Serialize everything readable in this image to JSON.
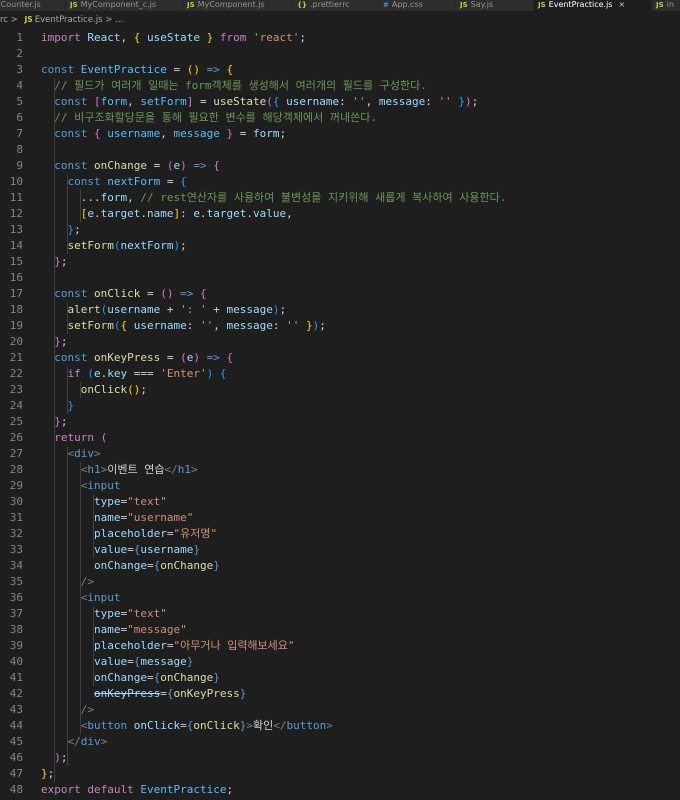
{
  "tabs": [
    {
      "label": "Counter.js",
      "icon": "JS"
    },
    {
      "label": "MyComponent_c.js",
      "icon": "JS"
    },
    {
      "label": "MyComponent.js",
      "icon": "JS"
    },
    {
      "label": ".prettierrc",
      "icon": "{}"
    },
    {
      "label": "App.css",
      "icon": "#"
    },
    {
      "label": "Say.js",
      "icon": "JS"
    },
    {
      "label": "EventPractice.js",
      "icon": "JS",
      "active": true
    },
    {
      "label": "in",
      "icon": "JS"
    }
  ],
  "breadcrumb": {
    "folder": "rc",
    "file_icon": "JS",
    "file": "EventPractice.js",
    "tail": "..."
  },
  "colors": {
    "editor_bg": "#1e1e1e",
    "keyword": "#569cd6",
    "control": "#c586c0",
    "string": "#ce9178",
    "comment": "#6a9955",
    "variable": "#9cdcfe",
    "function": "#dcdcaa"
  },
  "code_lines": [
    [
      [
        "kc",
        "import "
      ],
      [
        "var",
        "React"
      ],
      [
        "pn",
        ", "
      ],
      [
        "b1",
        "{ "
      ],
      [
        "var",
        "useState "
      ],
      [
        "b1",
        "}"
      ],
      [
        "kc",
        " from "
      ],
      [
        "str",
        "'react'"
      ],
      [
        "pn",
        ";"
      ]
    ],
    [],
    [
      [
        "kw",
        "const "
      ],
      [
        "cn",
        "EventPractice"
      ],
      [
        "pn",
        " = "
      ],
      [
        "b1",
        "()"
      ],
      [
        "kw",
        " => "
      ],
      [
        "b1",
        "{"
      ]
    ],
    [
      [
        "pn",
        "  "
      ],
      [
        "cm",
        "// 필드가 여러개 일때는 form객체를 생성해서 여러개의 필드를 구성한다."
      ]
    ],
    [
      [
        "pn",
        "  "
      ],
      [
        "kw",
        "const "
      ],
      [
        "b2",
        "["
      ],
      [
        "cn",
        "form"
      ],
      [
        "pn",
        ", "
      ],
      [
        "cn",
        "setForm"
      ],
      [
        "b2",
        "]"
      ],
      [
        "pn",
        " = "
      ],
      [
        "fn",
        "useState"
      ],
      [
        "b2",
        "("
      ],
      [
        "b3",
        "{ "
      ],
      [
        "var",
        "username"
      ],
      [
        "pn",
        ": "
      ],
      [
        "str",
        "''"
      ],
      [
        "pn",
        ", "
      ],
      [
        "var",
        "message"
      ],
      [
        "pn",
        ": "
      ],
      [
        "str",
        "'' "
      ],
      [
        "b3",
        "}"
      ],
      [
        "b2",
        ")"
      ],
      [
        "pn",
        ";"
      ]
    ],
    [
      [
        "pn",
        "  "
      ],
      [
        "cm",
        "// 비구조화할당문을 통해 필요한 변수를 해당객체에서 꺼내쓴다."
      ]
    ],
    [
      [
        "pn",
        "  "
      ],
      [
        "kw",
        "const "
      ],
      [
        "b2",
        "{ "
      ],
      [
        "cn",
        "username"
      ],
      [
        "pn",
        ", "
      ],
      [
        "cn",
        "message "
      ],
      [
        "b2",
        "}"
      ],
      [
        "pn",
        " = "
      ],
      [
        "var",
        "form"
      ],
      [
        "pn",
        ";"
      ]
    ],
    [],
    [
      [
        "pn",
        "  "
      ],
      [
        "kw",
        "const "
      ],
      [
        "fn",
        "onChange"
      ],
      [
        "pn",
        " = "
      ],
      [
        "b2",
        "("
      ],
      [
        "var",
        "e"
      ],
      [
        "b2",
        ")"
      ],
      [
        "kw",
        " => "
      ],
      [
        "b2",
        "{"
      ]
    ],
    [
      [
        "pn",
        "    "
      ],
      [
        "kw",
        "const "
      ],
      [
        "cn",
        "nextForm"
      ],
      [
        "pn",
        " = "
      ],
      [
        "b3",
        "{"
      ]
    ],
    [
      [
        "pn",
        "      ..."
      ],
      [
        "var",
        "form"
      ],
      [
        "pn",
        ", "
      ],
      [
        "cm",
        "// rest연산자를 사용하여 불변성을 지키위해 새롭게 복사하여 사용한다."
      ]
    ],
    [
      [
        "pn",
        "      "
      ],
      [
        "b1",
        "["
      ],
      [
        "var",
        "e"
      ],
      [
        "pn",
        "."
      ],
      [
        "var",
        "target"
      ],
      [
        "pn",
        "."
      ],
      [
        "var",
        "name"
      ],
      [
        "b1",
        "]"
      ],
      [
        "pn",
        ": "
      ],
      [
        "var",
        "e"
      ],
      [
        "pn",
        "."
      ],
      [
        "var",
        "target"
      ],
      [
        "pn",
        "."
      ],
      [
        "var",
        "value"
      ],
      [
        "pn",
        ","
      ]
    ],
    [
      [
        "pn",
        "    "
      ],
      [
        "b3",
        "}"
      ],
      [
        "pn",
        ";"
      ]
    ],
    [
      [
        "pn",
        "    "
      ],
      [
        "fn",
        "setForm"
      ],
      [
        "b3",
        "("
      ],
      [
        "var",
        "nextForm"
      ],
      [
        "b3",
        ")"
      ],
      [
        "pn",
        ";"
      ]
    ],
    [
      [
        "pn",
        "  "
      ],
      [
        "b2",
        "}"
      ],
      [
        "pn",
        ";"
      ]
    ],
    [],
    [
      [
        "pn",
        "  "
      ],
      [
        "kw",
        "const "
      ],
      [
        "fn",
        "onClick"
      ],
      [
        "pn",
        " = "
      ],
      [
        "b2",
        "()"
      ],
      [
        "kw",
        " => "
      ],
      [
        "b2",
        "{"
      ]
    ],
    [
      [
        "pn",
        "    "
      ],
      [
        "fn",
        "alert"
      ],
      [
        "b3",
        "("
      ],
      [
        "var",
        "username"
      ],
      [
        "pn",
        " + "
      ],
      [
        "str",
        "': '"
      ],
      [
        "pn",
        " + "
      ],
      [
        "var",
        "message"
      ],
      [
        "b3",
        ")"
      ],
      [
        "pn",
        ";"
      ]
    ],
    [
      [
        "pn",
        "    "
      ],
      [
        "fn",
        "setForm"
      ],
      [
        "b3",
        "("
      ],
      [
        "b1",
        "{ "
      ],
      [
        "var",
        "username"
      ],
      [
        "pn",
        ": "
      ],
      [
        "str",
        "''"
      ],
      [
        "pn",
        ", "
      ],
      [
        "var",
        "message"
      ],
      [
        "pn",
        ": "
      ],
      [
        "str",
        "'' "
      ],
      [
        "b1",
        "}"
      ],
      [
        "b3",
        ")"
      ],
      [
        "pn",
        ";"
      ]
    ],
    [
      [
        "pn",
        "  "
      ],
      [
        "b2",
        "}"
      ],
      [
        "pn",
        ";"
      ]
    ],
    [
      [
        "pn",
        "  "
      ],
      [
        "kw",
        "const "
      ],
      [
        "fn",
        "onKeyPress"
      ],
      [
        "pn",
        " = "
      ],
      [
        "b2",
        "("
      ],
      [
        "var",
        "e"
      ],
      [
        "b2",
        ")"
      ],
      [
        "kw",
        " => "
      ],
      [
        "b2",
        "{"
      ]
    ],
    [
      [
        "pn",
        "    "
      ],
      [
        "kc",
        "if "
      ],
      [
        "b3",
        "("
      ],
      [
        "var",
        "e"
      ],
      [
        "pn",
        "."
      ],
      [
        "var",
        "key"
      ],
      [
        "pn",
        " === "
      ],
      [
        "str",
        "'Enter'"
      ],
      [
        "b3",
        ")"
      ],
      [
        "pn",
        " "
      ],
      [
        "b3",
        "{"
      ]
    ],
    [
      [
        "pn",
        "      "
      ],
      [
        "fn",
        "onClick"
      ],
      [
        "b1",
        "()"
      ],
      [
        "pn",
        ";"
      ]
    ],
    [
      [
        "pn",
        "    "
      ],
      [
        "b3",
        "}"
      ]
    ],
    [
      [
        "pn",
        "  "
      ],
      [
        "b2",
        "}"
      ],
      [
        "pn",
        ";"
      ]
    ],
    [
      [
        "pn",
        "  "
      ],
      [
        "kc",
        "return "
      ],
      [
        "b2",
        "("
      ]
    ],
    [
      [
        "pn",
        "    "
      ],
      [
        "tg",
        "<"
      ],
      [
        "tn",
        "div"
      ],
      [
        "tg",
        ">"
      ]
    ],
    [
      [
        "pn",
        "      "
      ],
      [
        "tg",
        "<"
      ],
      [
        "tn",
        "h1"
      ],
      [
        "tg",
        ">"
      ],
      [
        "tx",
        "이벤트 연습"
      ],
      [
        "tg",
        "</"
      ],
      [
        "tn",
        "h1"
      ],
      [
        "tg",
        ">"
      ]
    ],
    [
      [
        "pn",
        "      "
      ],
      [
        "tg",
        "<"
      ],
      [
        "tn",
        "input"
      ]
    ],
    [
      [
        "pn",
        "        "
      ],
      [
        "at",
        "type"
      ],
      [
        "pn",
        "="
      ],
      [
        "str",
        "\"text\""
      ]
    ],
    [
      [
        "pn",
        "        "
      ],
      [
        "at",
        "name"
      ],
      [
        "pn",
        "="
      ],
      [
        "str",
        "\"username\""
      ]
    ],
    [
      [
        "pn",
        "        "
      ],
      [
        "at",
        "placeholder"
      ],
      [
        "pn",
        "="
      ],
      [
        "str",
        "\"유저명\""
      ]
    ],
    [
      [
        "pn",
        "        "
      ],
      [
        "at",
        "value"
      ],
      [
        "pn",
        "="
      ],
      [
        "kw",
        "{"
      ],
      [
        "var",
        "username"
      ],
      [
        "kw",
        "}"
      ]
    ],
    [
      [
        "pn",
        "        "
      ],
      [
        "at",
        "onChange"
      ],
      [
        "pn",
        "="
      ],
      [
        "kw",
        "{"
      ],
      [
        "fn",
        "onChange"
      ],
      [
        "kw",
        "}"
      ]
    ],
    [
      [
        "pn",
        "      "
      ],
      [
        "tg",
        "/>"
      ]
    ],
    [
      [
        "pn",
        "      "
      ],
      [
        "tg",
        "<"
      ],
      [
        "tn",
        "input"
      ]
    ],
    [
      [
        "pn",
        "        "
      ],
      [
        "at",
        "type"
      ],
      [
        "pn",
        "="
      ],
      [
        "str",
        "\"text\""
      ]
    ],
    [
      [
        "pn",
        "        "
      ],
      [
        "at",
        "name"
      ],
      [
        "pn",
        "="
      ],
      [
        "str",
        "\"message\""
      ]
    ],
    [
      [
        "pn",
        "        "
      ],
      [
        "at",
        "placeholder"
      ],
      [
        "pn",
        "="
      ],
      [
        "str",
        "\"아무거나 입력해보세요\""
      ]
    ],
    [
      [
        "pn",
        "        "
      ],
      [
        "at",
        "value"
      ],
      [
        "pn",
        "="
      ],
      [
        "kw",
        "{"
      ],
      [
        "var",
        "message"
      ],
      [
        "kw",
        "}"
      ]
    ],
    [
      [
        "pn",
        "        "
      ],
      [
        "at",
        "onChange"
      ],
      [
        "pn",
        "="
      ],
      [
        "kw",
        "{"
      ],
      [
        "fn",
        "onChange"
      ],
      [
        "kw",
        "}"
      ]
    ],
    [
      [
        "pn",
        "        "
      ],
      [
        "at dep",
        "onKeyPress"
      ],
      [
        "pn",
        "="
      ],
      [
        "kw",
        "{"
      ],
      [
        "fn",
        "onKeyPress"
      ],
      [
        "kw",
        "}"
      ]
    ],
    [
      [
        "pn",
        "      "
      ],
      [
        "tg",
        "/>"
      ]
    ],
    [
      [
        "pn",
        "      "
      ],
      [
        "tg",
        "<"
      ],
      [
        "tn",
        "button "
      ],
      [
        "at",
        "onClick"
      ],
      [
        "pn",
        "="
      ],
      [
        "kw",
        "{"
      ],
      [
        "fn",
        "onClick"
      ],
      [
        "kw",
        "}"
      ],
      [
        "tg",
        ">"
      ],
      [
        "tx",
        "확인"
      ],
      [
        "tg",
        "</"
      ],
      [
        "tn",
        "button"
      ],
      [
        "tg",
        ">"
      ]
    ],
    [
      [
        "pn",
        "    "
      ],
      [
        "tg",
        "</"
      ],
      [
        "tn",
        "div"
      ],
      [
        "tg",
        ">"
      ]
    ],
    [
      [
        "pn",
        "  "
      ],
      [
        "b2",
        ")"
      ],
      [
        "pn",
        ";"
      ]
    ],
    [
      [
        "b1",
        "}"
      ],
      [
        "pn",
        ";"
      ]
    ],
    [
      [
        "kc",
        "export default "
      ],
      [
        "cn",
        "EventPractice"
      ],
      [
        "pn",
        ";"
      ]
    ]
  ]
}
